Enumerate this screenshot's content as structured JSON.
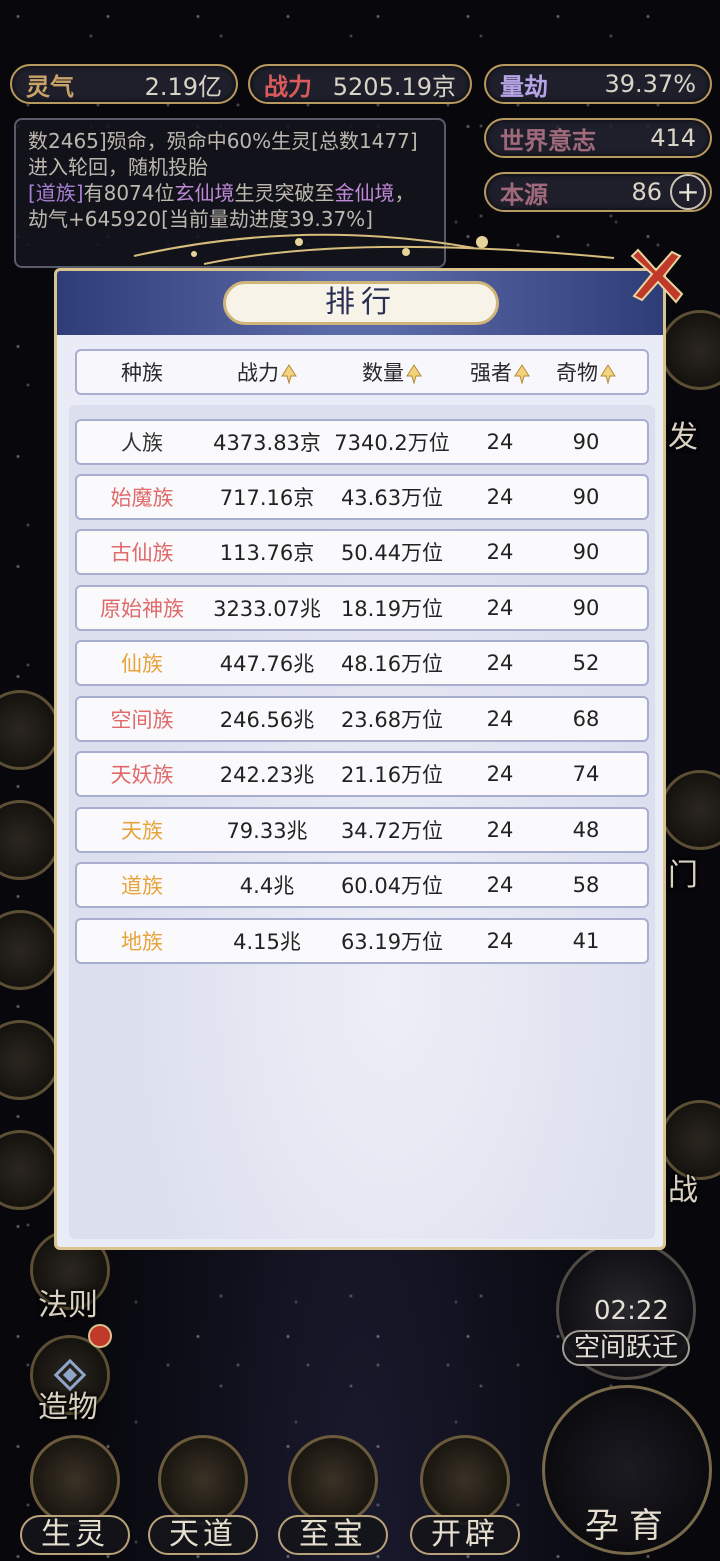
{
  "top_stats": {
    "lingqi": {
      "label": "灵气",
      "value": "2.19亿"
    },
    "zhanli": {
      "label": "战力",
      "value": "5205.19京"
    },
    "liangjie": {
      "label": "量劫",
      "value": "39.37%"
    },
    "shijie": {
      "label": "世界意志",
      "value": "414"
    },
    "benyuan": {
      "label": "本源",
      "value": "86"
    }
  },
  "log": {
    "line1": "数2465]殒命，殒命中60%生灵[总数1477]进入轮回，随机投胎",
    "line2_tag": "[道族]",
    "line2_a": "有8074位",
    "line2_realm": "玄仙境",
    "line2_b": "生灵突破至",
    "line2_realm2": "金仙境",
    "line2_c": "，劫气+645920[当前量劫进度39.37%]"
  },
  "modal": {
    "title": "排行",
    "headers": [
      "种族",
      "战力",
      "数量",
      "强者",
      "奇物"
    ]
  },
  "rows": [
    {
      "race": "人族",
      "power": "4373.83京",
      "count": "7340.2万位",
      "strong": "24",
      "items": "90",
      "color": "#333333"
    },
    {
      "race": "始魔族",
      "power": "717.16京",
      "count": "43.63万位",
      "strong": "24",
      "items": "90",
      "color": "#e06a6a"
    },
    {
      "race": "古仙族",
      "power": "113.76京",
      "count": "50.44万位",
      "strong": "24",
      "items": "90",
      "color": "#e06a6a"
    },
    {
      "race": "原始神族",
      "power": "3233.07兆",
      "count": "18.19万位",
      "strong": "24",
      "items": "90",
      "color": "#e06a6a"
    },
    {
      "race": "仙族",
      "power": "447.76兆",
      "count": "48.16万位",
      "strong": "24",
      "items": "52",
      "color": "#e8a33a"
    },
    {
      "race": "空间族",
      "power": "246.56兆",
      "count": "23.68万位",
      "strong": "24",
      "items": "68",
      "color": "#e06a6a"
    },
    {
      "race": "天妖族",
      "power": "242.23兆",
      "count": "21.16万位",
      "strong": "24",
      "items": "74",
      "color": "#e06a6a"
    },
    {
      "race": "天族",
      "power": "79.33兆",
      "count": "34.72万位",
      "strong": "24",
      "items": "48",
      "color": "#e8a33a"
    },
    {
      "race": "道族",
      "power": "4.4兆",
      "count": "60.04万位",
      "strong": "24",
      "items": "58",
      "color": "#e8a33a"
    },
    {
      "race": "地族",
      "power": "4.15兆",
      "count": "63.19万位",
      "strong": "24",
      "items": "41",
      "color": "#e8a33a"
    }
  ],
  "side": {
    "fa": "发",
    "men": "门",
    "zhan": "战",
    "faze": "法则",
    "zaowu": "造物"
  },
  "timer": {
    "time": "02:22",
    "label": "空间跃迁"
  },
  "bottom": [
    "生灵",
    "天道",
    "至宝",
    "开辟"
  ],
  "yunyu": "孕育"
}
